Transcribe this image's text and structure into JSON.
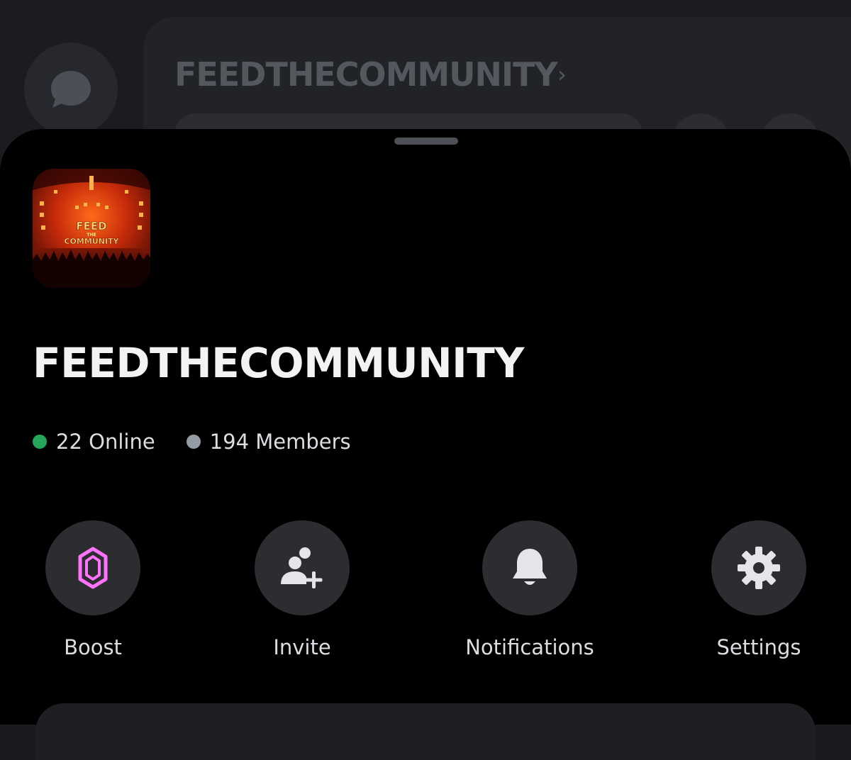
{
  "background": {
    "server_title": "FEEDTHECOMMUNITY",
    "chevron": "›",
    "dm_icon": "chat-bubble-icon"
  },
  "server": {
    "name": "FEEDTHECOMMUNITY",
    "icon_text": {
      "line1": "FEED",
      "line2": "THE",
      "line3": "COMMUNITY"
    },
    "online_count_label": "22 Online",
    "members_count_label": "194 Members",
    "online_color": "#23a55a",
    "members_color": "#949ba4"
  },
  "actions": [
    {
      "label": "Boost",
      "icon": "nitro-gem-icon"
    },
    {
      "label": "Invite",
      "icon": "add-friend-icon"
    },
    {
      "label": "Notifications",
      "icon": "bell-icon"
    },
    {
      "label": "Settings",
      "icon": "gear-icon"
    }
  ],
  "colors": {
    "boost_accent": "#ff73fa",
    "sheet_bg": "#000000"
  }
}
